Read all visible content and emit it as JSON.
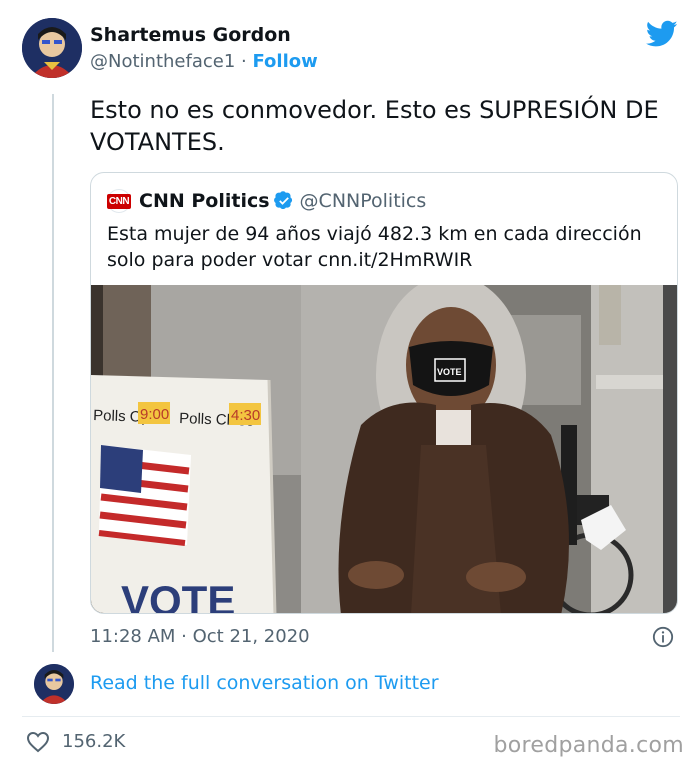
{
  "author": {
    "name": "Shartemus Gordon",
    "handle": "@Notintheface1",
    "separator": "·",
    "follow_label": "Follow"
  },
  "tweet": {
    "text": "Esto no es conmovedor. Esto es SUPRESIÓN DE VOTANTES."
  },
  "quoted": {
    "logo_text": "CNN",
    "name": "CNN Politics",
    "handle": "@CNNPolitics",
    "text": "Esta mujer de 94 años viajó 482.3 km en cada dirección solo para poder votar cnn.it/2HmRWIR",
    "photo": {
      "sign_polls_open": "Polls Open",
      "sign_open_time": "9:00",
      "sign_polls_close": "Polls Close",
      "sign_close_time": "4:30",
      "sign_vote": "VOTE",
      "mask_text": "VOTE"
    }
  },
  "meta": {
    "timestamp": "11:28 AM · Oct 21, 2020"
  },
  "conversation_link": "Read the full conversation on Twitter",
  "likes": "156.2K",
  "watermark": "boredpanda.com",
  "colors": {
    "twitter_blue": "#1d9bf0",
    "text_primary": "#0f1419",
    "text_secondary": "#536471",
    "border": "#cfd9de"
  }
}
